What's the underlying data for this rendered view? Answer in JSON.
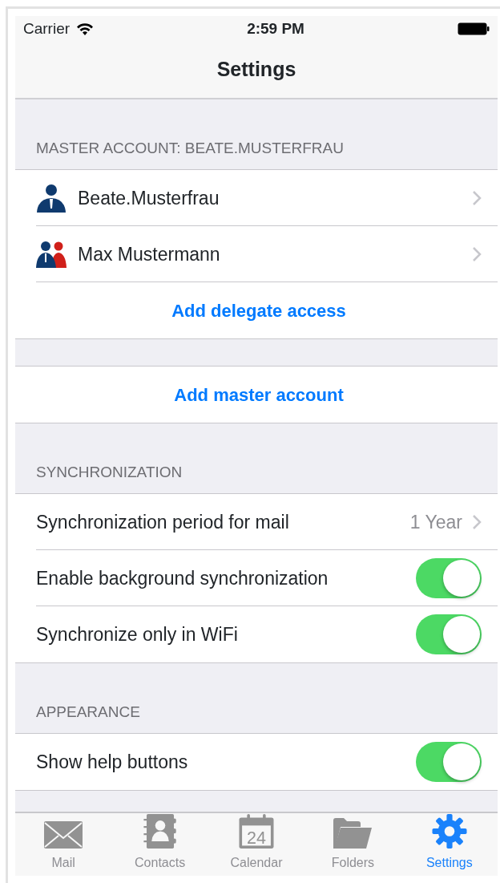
{
  "status_bar": {
    "carrier": "Carrier",
    "time": "2:59 PM"
  },
  "nav": {
    "title": "Settings"
  },
  "sections": [
    {
      "header": "MASTER ACCOUNT: BEATE.MUSTERFRAU",
      "rows": [
        {
          "kind": "account",
          "label": "Beate.Musterfrau"
        },
        {
          "kind": "account",
          "label": "Max Mustermann"
        },
        {
          "kind": "action",
          "label": "Add delegate access"
        }
      ]
    },
    {
      "rows": [
        {
          "kind": "action",
          "label": "Add master account"
        }
      ]
    },
    {
      "header": "SYNCHRONIZATION",
      "rows": [
        {
          "kind": "detail",
          "label": "Synchronization period for mail",
          "value": "1 Year"
        },
        {
          "kind": "toggle",
          "label": "Enable background synchronization",
          "on": true
        },
        {
          "kind": "toggle",
          "label": "Synchronize only in WiFi",
          "on": true
        }
      ]
    },
    {
      "header": "APPEARANCE",
      "rows": [
        {
          "kind": "toggle",
          "label": "Show help buttons",
          "on": true
        }
      ]
    }
  ],
  "tab_bar": [
    {
      "label": "Mail",
      "selected": false
    },
    {
      "label": "Contacts",
      "selected": false
    },
    {
      "label": "Calendar",
      "day": "24",
      "selected": false
    },
    {
      "label": "Folders",
      "selected": false
    },
    {
      "label": "Settings",
      "selected": true
    }
  ]
}
